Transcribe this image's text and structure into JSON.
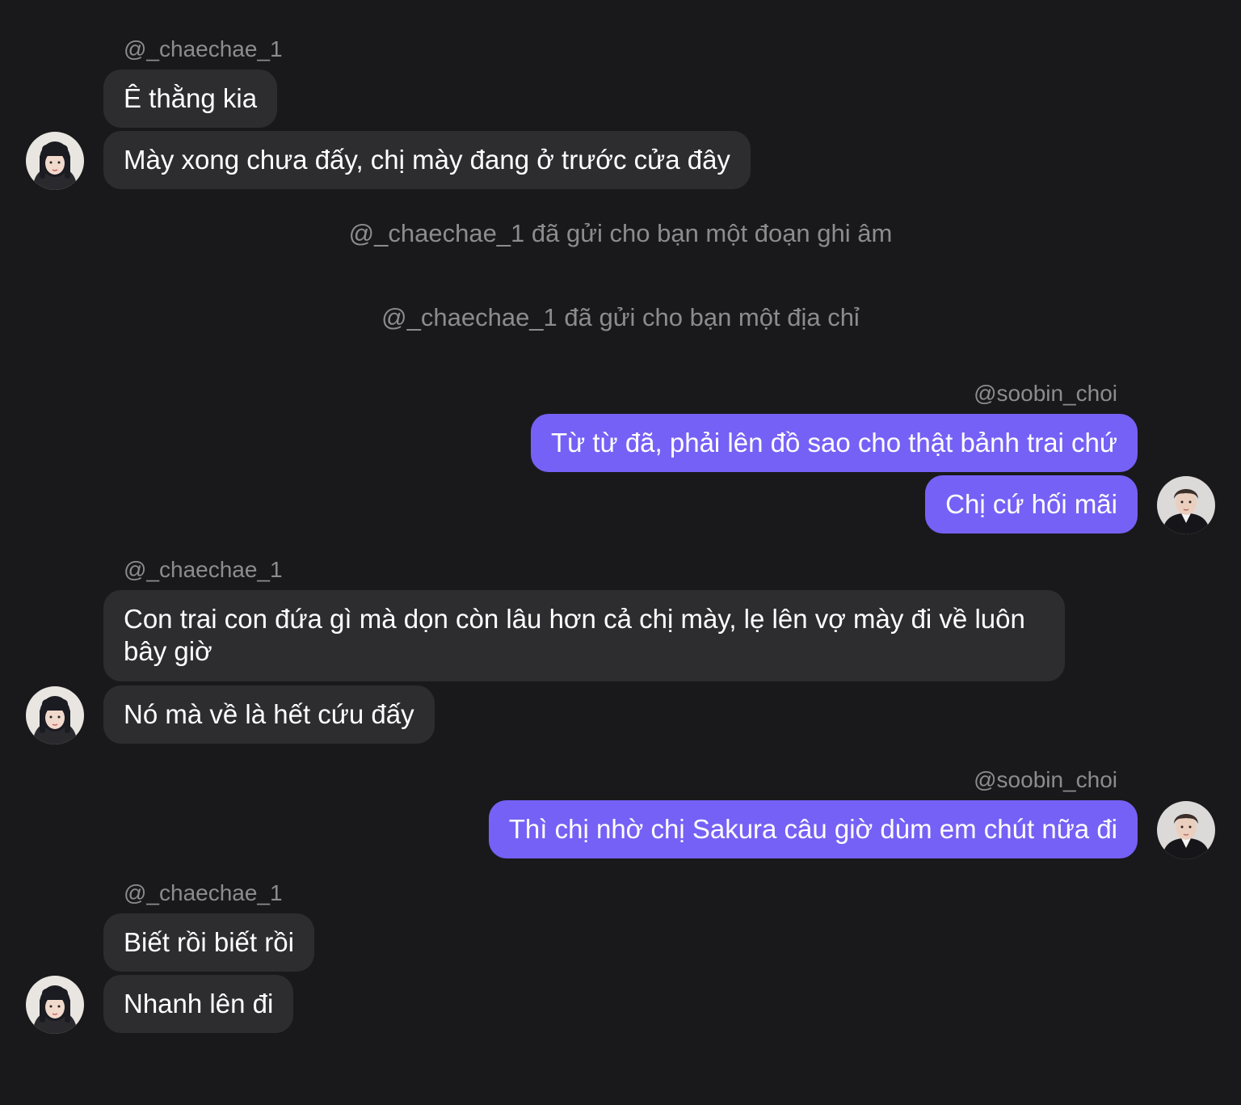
{
  "conversation": {
    "messages": [
      {
        "username": "@_chaechae_1",
        "lines": [
          "Ê thằng kia",
          "Mày xong chưa đấy, chị mày đang ở trước cửa đây"
        ]
      },
      {
        "system": "@_chaechae_1 đã gửi cho bạn một đoạn ghi âm"
      },
      {
        "system": "@_chaechae_1 đã gửi cho bạn một địa chỉ"
      },
      {
        "username": "@soobin_choi",
        "lines": [
          "Từ từ đã, phải lên đồ sao cho thật bảnh trai chứ",
          "Chị cứ hối mãi"
        ]
      },
      {
        "username": "@_chaechae_1",
        "lines": [
          "Con trai con đứa gì mà dọn còn lâu hơn cả chị mày, lẹ lên vợ mày đi về luôn bây giờ",
          "Nó mà về là hết cứu đấy"
        ]
      },
      {
        "username": "@soobin_choi",
        "lines": [
          "Thì chị nhờ chị Sakura câu giờ dùm em chút nữa đi"
        ]
      },
      {
        "username": "@_chaechae_1",
        "lines": [
          "Biết rồi biết rồi",
          "Nhanh lên đi"
        ]
      }
    ]
  },
  "colors": {
    "background": "#19191b",
    "incoming_bubble": "#2d2d30",
    "outgoing_bubble": "#7561f5",
    "meta_text": "#8c8c90",
    "message_text": "#ffffff"
  },
  "icons": {
    "incoming_avatar": "avatar-girl-photo",
    "outgoing_avatar": "avatar-boy-photo"
  }
}
